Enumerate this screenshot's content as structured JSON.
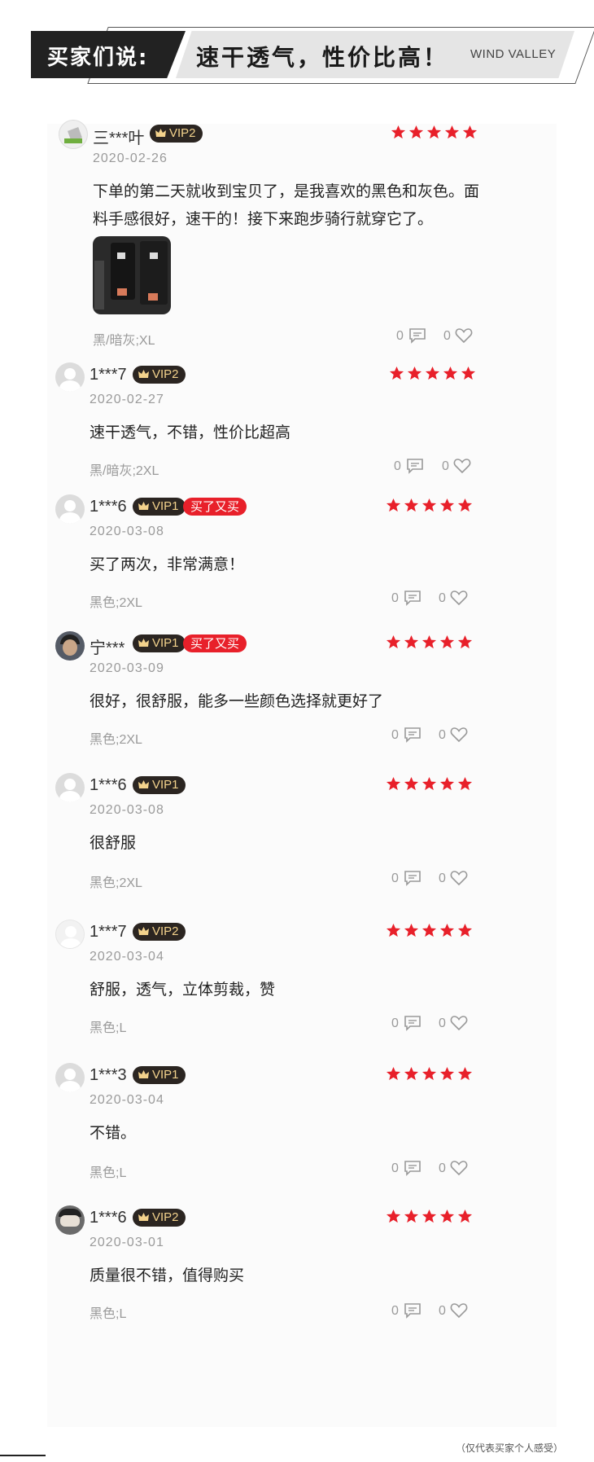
{
  "banner": {
    "left_label": "买家们说:",
    "title": "速干透气，性价比高！",
    "brand": "WIND VALLEY"
  },
  "colors": {
    "star": "#e8202a",
    "vip_bg": "#2b2521",
    "vip_text": "#f3d28c",
    "buy_again_bg": "#e8202a"
  },
  "reviews": [
    {
      "name": "三***叶",
      "vip": "VIP2",
      "tag": "",
      "date": "2020-02-26",
      "text": "下单的第二天就收到宝贝了，是我喜欢的黑色和灰色。面料手感很好，速干的！接下来跑步骑行就穿它了。",
      "sku": "黑/暗灰;XL",
      "comments": "0",
      "likes": "0",
      "stars": 5,
      "avatar_icon": "user-photo-icon"
    },
    {
      "name": "1***7",
      "vip": "VIP2",
      "tag": "",
      "date": "2020-02-27",
      "text": "速干透气，不错，性价比超高",
      "sku": "黑/暗灰;2XL",
      "comments": "0",
      "likes": "0",
      "stars": 5,
      "avatar_icon": "default-avatar-icon"
    },
    {
      "name": "1***6",
      "vip": "VIP1",
      "tag": "买了又买",
      "date": "2020-03-08",
      "text": "买了两次，非常满意！",
      "sku": "黑色;2XL",
      "comments": "0",
      "likes": "0",
      "stars": 5,
      "avatar_icon": "default-avatar-icon"
    },
    {
      "name": "宁***",
      "vip": "VIP1",
      "tag": "买了又买",
      "date": "2020-03-09",
      "text": "很好，很舒服，能多一些颜色选择就更好了",
      "sku": "黑色;2XL",
      "comments": "0",
      "likes": "0",
      "stars": 5,
      "avatar_icon": "user-photo-icon"
    },
    {
      "name": "1***6",
      "vip": "VIP1",
      "tag": "",
      "date": "2020-03-08",
      "text": "很舒服",
      "sku": "黑色;2XL",
      "comments": "0",
      "likes": "0",
      "stars": 5,
      "avatar_icon": "default-avatar-icon"
    },
    {
      "name": "1***7",
      "vip": "VIP2",
      "tag": "",
      "date": "2020-03-04",
      "text": "舒服，透气，立体剪裁，赞",
      "sku": "黑色;L",
      "comments": "0",
      "likes": "0",
      "stars": 5,
      "avatar_icon": "default-avatar-icon"
    },
    {
      "name": "1***3",
      "vip": "VIP1",
      "tag": "",
      "date": "2020-03-04",
      "text": "不错。",
      "sku": "黑色;L",
      "comments": "0",
      "likes": "0",
      "stars": 5,
      "avatar_icon": "default-avatar-icon"
    },
    {
      "name": "1***6",
      "vip": "VIP2",
      "tag": "",
      "date": "2020-03-01",
      "text": "质量很不错，值得购买",
      "sku": "黑色;L",
      "comments": "0",
      "likes": "0",
      "stars": 5,
      "avatar_icon": "user-photo-icon"
    }
  ],
  "footnote": "（仅代表买家个人感受）"
}
